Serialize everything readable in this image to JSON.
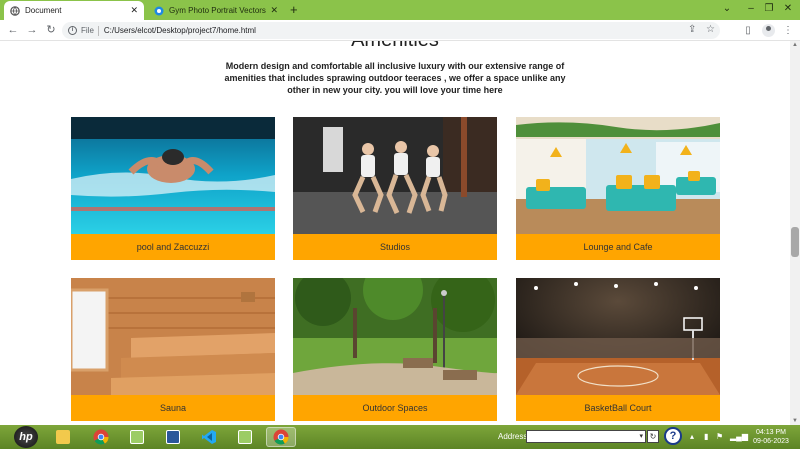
{
  "browser": {
    "tabs": [
      {
        "title": "Document",
        "active": true
      },
      {
        "title": "Gym Photo Portrait Vectors, Photo",
        "active": false
      }
    ],
    "new_tab": "+",
    "url_scheme": "File",
    "url": "C:/Users/elcot/Desktop/project7/home.html"
  },
  "page": {
    "heading": "Amenities",
    "description": "Modern design and comfortable all inclusive luxury with our extensive range of amenities that includes sprawing outdoor teeraces , we offer a space unlike any other in new your city. you will love your time here",
    "cards": [
      {
        "caption": "pool and Zaccuzzi",
        "image": "swimmer-photo"
      },
      {
        "caption": "Studios",
        "image": "gym-class-photo"
      },
      {
        "caption": "Lounge and Cafe",
        "image": "cafe-lounge-photo"
      },
      {
        "caption": "Sauna",
        "image": "sauna-photo"
      },
      {
        "caption": "Outdoor Spaces",
        "image": "park-photo"
      },
      {
        "caption": "BasketBall Court",
        "image": "basketball-arena-photo"
      }
    ],
    "accent_color": "#ffa500"
  },
  "taskbar": {
    "start_label": "hp",
    "address_label": "Address",
    "address_value": "",
    "time": "04:13 PM",
    "date": "09-06-2023"
  },
  "colors": {
    "tab_strip": "#8bc34a",
    "taskbar": "#6b9430",
    "caption_bg": "#ffa500"
  }
}
